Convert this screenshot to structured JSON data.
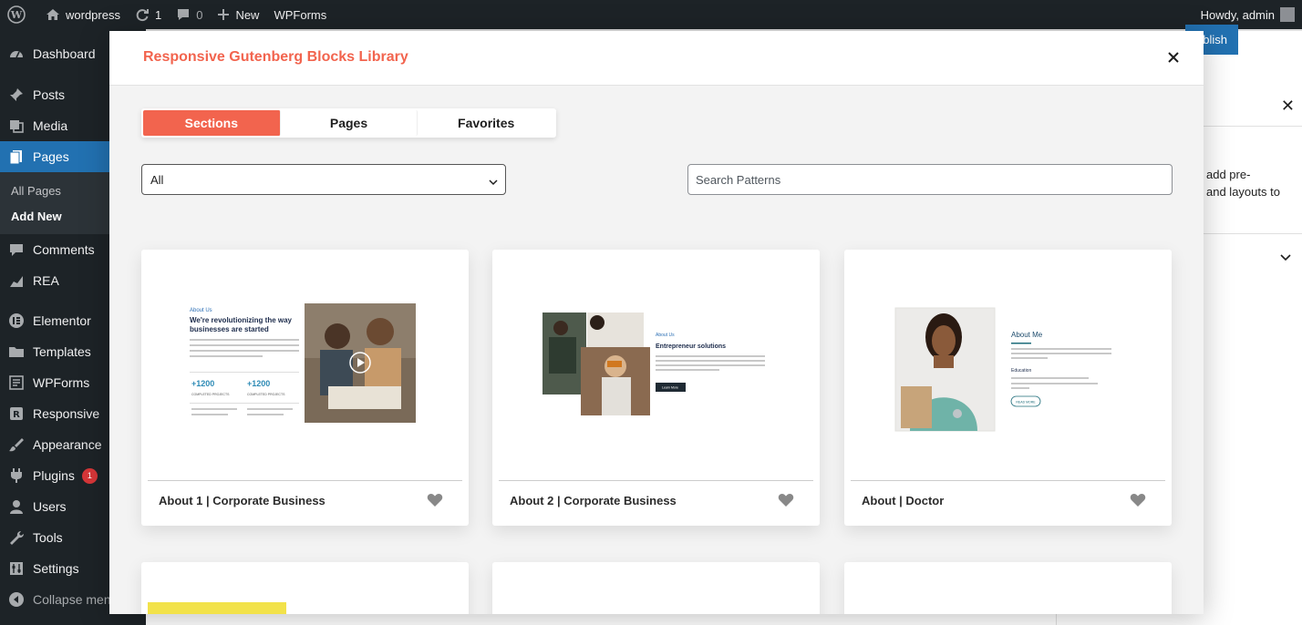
{
  "adminbar": {
    "site_name": "wordpress",
    "updates_count": "1",
    "comments_count": "0",
    "new_label": "New",
    "wpforms_label": "WPForms",
    "howdy": "Howdy, admin"
  },
  "sidebar": {
    "items": [
      {
        "label": "Dashboard",
        "icon": "dashboard-icon"
      },
      {
        "label": "Posts",
        "icon": "pin-icon"
      },
      {
        "label": "Media",
        "icon": "media-icon"
      },
      {
        "label": "Pages",
        "icon": "page-icon"
      },
      {
        "label": "Comments",
        "icon": "comment-icon"
      },
      {
        "label": "REA",
        "icon": "chart-icon"
      },
      {
        "label": "Elementor",
        "icon": "elementor-icon"
      },
      {
        "label": "Templates",
        "icon": "folder-icon"
      },
      {
        "label": "WPForms",
        "icon": "form-icon"
      },
      {
        "label": "Responsive",
        "icon": "r-icon"
      },
      {
        "label": "Appearance",
        "icon": "brush-icon"
      },
      {
        "label": "Plugins",
        "icon": "plug-icon",
        "badge": "1"
      },
      {
        "label": "Users",
        "icon": "user-icon"
      },
      {
        "label": "Tools",
        "icon": "wrench-icon"
      },
      {
        "label": "Settings",
        "icon": "settings-icon"
      },
      {
        "label": "Collapse menu",
        "icon": "collapse-icon"
      }
    ],
    "submenu": [
      "All Pages",
      "Add New"
    ]
  },
  "editor": {
    "publish_label": "Publish",
    "panel_text": "add pre-\nand layouts to"
  },
  "modal": {
    "title": "Responsive Gutenberg Blocks Library",
    "tabs": [
      "Sections",
      "Pages",
      "Favorites"
    ],
    "active_tab": "Sections",
    "category_select": "All",
    "search_placeholder": "Search Patterns",
    "cards": [
      {
        "title": "About 1 | Corporate Business",
        "preview": {
          "eyebrow": "About Us",
          "heading": "We're revolutionizing the way businesses are started",
          "stat1": "+1200",
          "stat1_label": "COMPLETED PROJECTS",
          "stat2": "+1200",
          "stat2_label": "COMPLETED PROJECTS"
        }
      },
      {
        "title": "About 2 | Corporate Business",
        "preview": {
          "eyebrow": "About Us",
          "heading": "Entrepreneur solutions",
          "button": "Learn More"
        }
      },
      {
        "title": "About | Doctor",
        "preview": {
          "heading": "About Me",
          "subheading": "Education",
          "button": "READ MORE"
        }
      }
    ]
  },
  "colors": {
    "accent": "#f2644e",
    "wp_dark": "#1d2327",
    "wp_blue": "#2271b1"
  }
}
